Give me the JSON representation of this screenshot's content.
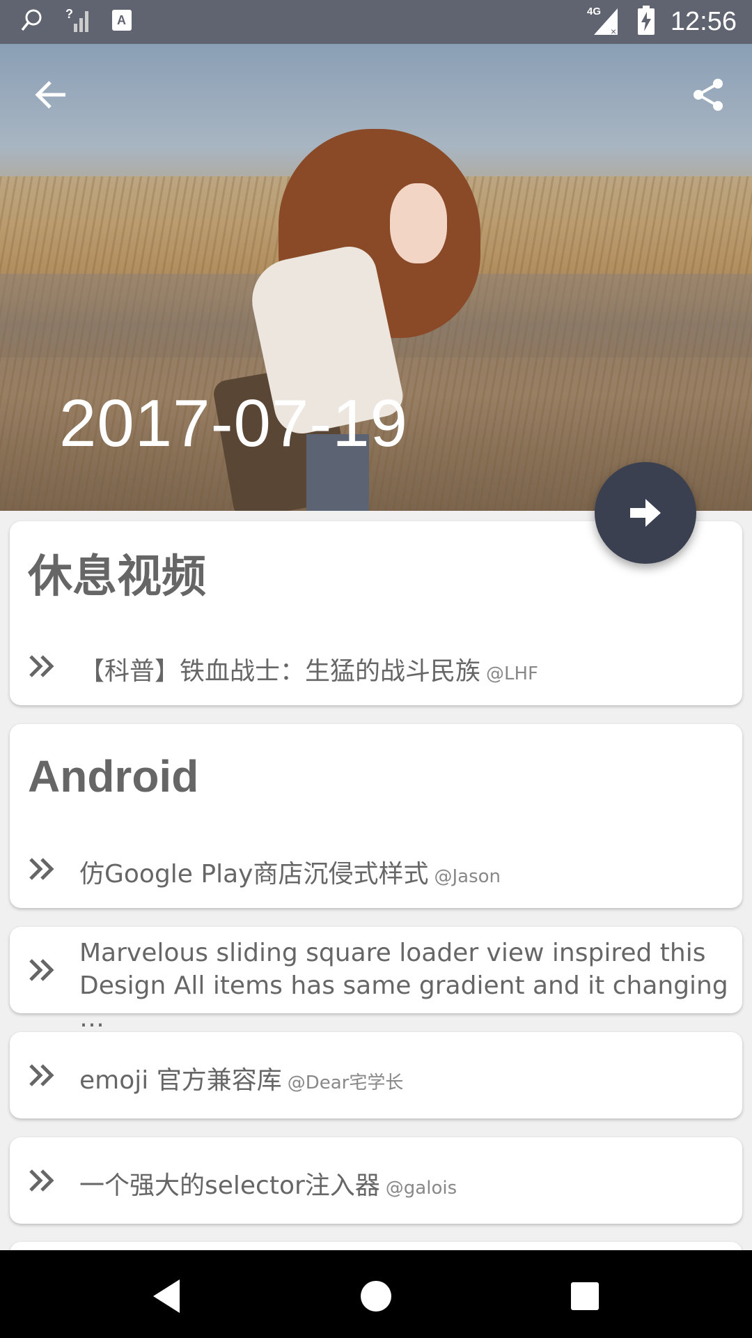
{
  "status_bar": {
    "time": "12:56",
    "network": "4G",
    "icons": [
      "search-icon",
      "signal-unknown-icon",
      "keyboard-a-icon",
      "signal-4g-icon",
      "battery-charging-icon"
    ]
  },
  "header": {
    "date": "2017-07-19",
    "back_icon": "arrow-back-icon",
    "share_icon": "share-icon",
    "fab_icon": "arrow-forward-icon"
  },
  "sections": [
    {
      "title": "休息视频",
      "items": [
        {
          "text": "【科普】铁血战士：生猛的战斗民族",
          "author": "@LHF"
        }
      ]
    },
    {
      "title": "Android",
      "items": [
        {
          "text": "仿Google Play商店沉侵式样式",
          "author": "@Jason"
        }
      ]
    }
  ],
  "items": [
    {
      "text": "Marvelous sliding square loader view inspired this Design All items has same gradient and it changing …",
      "author": ""
    },
    {
      "text": "emoji 官方兼容库",
      "author": "@Dear宅学长"
    },
    {
      "text": "一个强大的selector注入器",
      "author": "@galois"
    }
  ],
  "colors": {
    "status_bar": "#5f6470",
    "fab": "#3a4050",
    "text_gray": "#666666",
    "background": "#f0f0f0"
  }
}
